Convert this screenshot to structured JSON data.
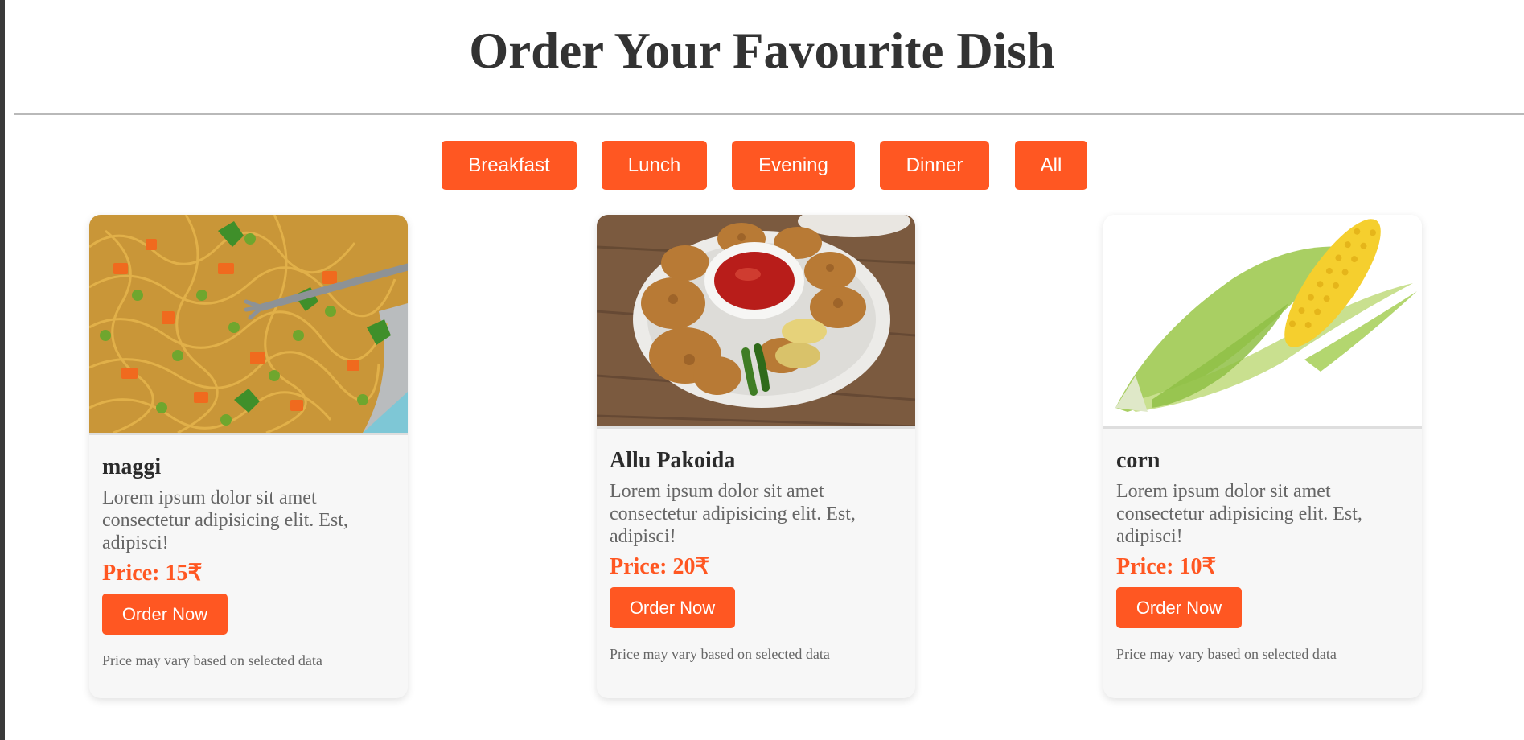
{
  "page": {
    "title": "Order Your Favourite Dish"
  },
  "filters": [
    {
      "label": "Breakfast"
    },
    {
      "label": "Lunch"
    },
    {
      "label": "Evening"
    },
    {
      "label": "Dinner"
    },
    {
      "label": "All"
    }
  ],
  "dishes": [
    {
      "name": "maggi",
      "description": "Lorem ipsum dolor sit amet consectetur adipisicing elit. Est, adipisci!",
      "price": "Price: 15₹",
      "order_label": "Order Now",
      "note": "Price may vary based on selected data",
      "image": "noodles-photo"
    },
    {
      "name": "Allu Pakoida",
      "description": "Lorem ipsum dolor sit amet consectetur adipisicing elit. Est, adipisci!",
      "price": "Price: 20₹",
      "order_label": "Order Now",
      "note": "Price may vary based on selected data",
      "image": "pakoda-photo"
    },
    {
      "name": "corn",
      "description": "Lorem ipsum dolor sit amet consectetur adipisicing elit. Est, adipisci!",
      "price": "Price: 10₹",
      "order_label": "Order Now",
      "note": "Price may vary based on selected data",
      "image": "corn-photo"
    }
  ],
  "colors": {
    "accent": "#ff5722",
    "card_bg": "#f7f7f7",
    "title": "#333333",
    "muted": "#666666"
  }
}
